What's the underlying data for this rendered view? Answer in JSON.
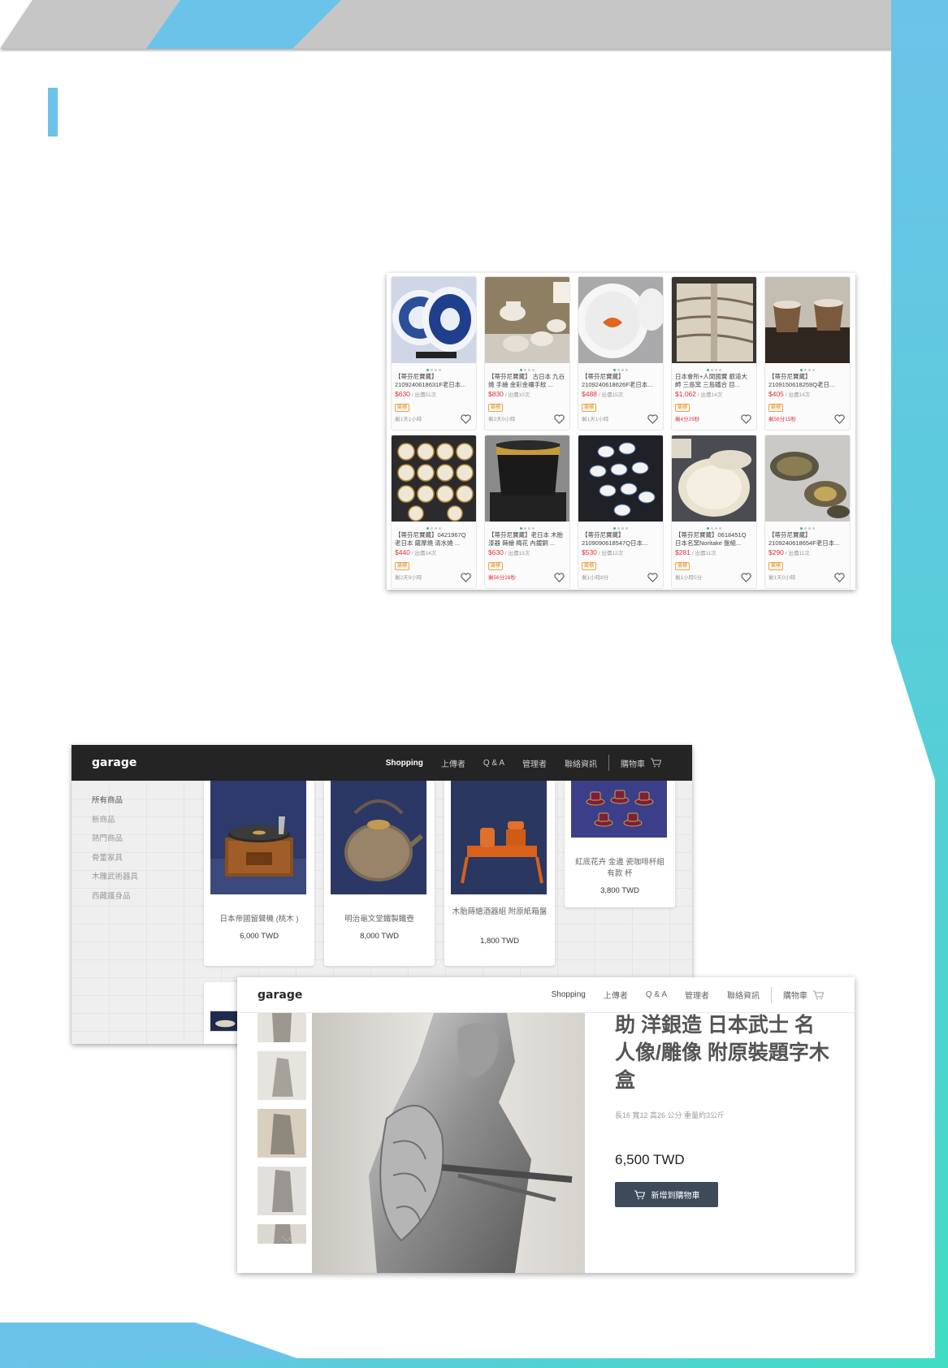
{
  "colors": {
    "accent_blue": "#6cc3ea",
    "accent_teal": "#47d9c6",
    "band_gray": "#c4c4c4",
    "price_red": "#e0323a",
    "navbar_dark": "#242424",
    "button_dark": "#3c4a5a"
  },
  "grid_screenshot": {
    "products": [
      {
        "title": "【蒂芬尼寶藏】2109240618631F老日本...",
        "price": "$630",
        "bids": " / 出價51次",
        "badge": "競標",
        "time": "剩1天1小時",
        "time_color": "gray",
        "icon": "blue-white-plates"
      },
      {
        "title": "【蒂芬尼寶藏】 古日本 九谷燒 手繪 金彩金襴手紋 ...",
        "price": "$830",
        "bids": " / 出價10次",
        "badge": "競標",
        "time": "剩2天0小時",
        "time_color": "gray",
        "icon": "kutani-tea-set"
      },
      {
        "title": "【蒂芬尼寶藏】2109240618626F老日本...",
        "price": "$488",
        "bids": " / 出價15次",
        "badge": "競標",
        "time": "剩1天1小時",
        "time_color": "gray",
        "icon": "goldfish-bowl"
      },
      {
        "title": "日本會所+人間國寶 叡道大師 三島窯 三島鐵合 目...",
        "price": "$1,062",
        "bids": " / 出價14次",
        "badge": "競標",
        "time": "剩4分29秒",
        "time_color": "red",
        "icon": "stoneware-vessel"
      },
      {
        "title": "【蒂芬尼寶藏】2109150618259Q老日...",
        "price": "$405",
        "bids": " / 出價14次",
        "badge": "競標",
        "time": "剩56分15秒",
        "time_color": "red",
        "icon": "brown-cups"
      },
      {
        "title": "【蒂芬尼寶藏】0421967Q 老日本 薩摩燒 清水燒 ...",
        "price": "$440",
        "bids": " / 出價14次",
        "badge": "競標",
        "time": "剩2天9小時",
        "time_color": "gray",
        "icon": "satsuma-cups"
      },
      {
        "title": "【蒂芬尼寶藏】老日本 木胎 漆器 蒔繪 梅花 內鍍銅 ...",
        "price": "$630",
        "bids": " / 出價13次",
        "badge": "競標",
        "time": "剩56分28秒",
        "time_color": "red",
        "icon": "lacquer-brazier"
      },
      {
        "title": "【蒂芬尼寶藏】2109090618547Q日本...",
        "price": "$530",
        "bids": " / 出價12次",
        "badge": "競標",
        "time": "剩1小時8分",
        "time_color": "gray",
        "icon": "white-tea-cups"
      },
      {
        "title": "【蒂芬尼寶藏】0618451Q 日本名窯Noritake 盤組...",
        "price": "$281",
        "bids": " / 出價11次",
        "badge": "競標",
        "time": "剩1小時5分",
        "time_color": "gray",
        "icon": "noritake-plates"
      },
      {
        "title": "【蒂芬尼寶藏】2109240618654F老日本...",
        "price": "$290",
        "bids": " / 出價11次",
        "badge": "競標",
        "time": "剩1天0小時",
        "time_color": "gray",
        "icon": "gold-plates"
      }
    ]
  },
  "shop_screenshot": {
    "logo": "garage",
    "nav": {
      "shopping": "Shopping",
      "uploader": "上傳者",
      "qa": "Q & A",
      "admin": "管理者",
      "contact": "聯絡資訊",
      "cart": "購物車"
    },
    "categories": [
      "所有商品",
      "新商品",
      "熱門商品",
      "骨董家具",
      "木雕武術器具",
      "西藏護身品"
    ],
    "products": [
      {
        "name": "日本帝國留聲機 (桃木 )",
        "price": "6,000 TWD",
        "icon": "gramophone"
      },
      {
        "name": "明治龜文堂鐵製鐵壺",
        "price": "8,000 TWD",
        "icon": "iron-kettle"
      },
      {
        "name": "木胎蒔繪酒器組 附原紙箱盤",
        "price": "1,800 TWD",
        "icon": "lacquer-sake-set"
      },
      {
        "name": "紅底花卉 金邊 瓷咖啡杯組 有款 杯",
        "price": "3,800 TWD",
        "icon": "coffee-cups"
      }
    ]
  },
  "detail_screenshot": {
    "logo": "garage",
    "nav": {
      "shopping": "Shopping",
      "uploader": "上傳者",
      "qa": "Q & A",
      "admin": "管理者",
      "contact": "聯絡資訊",
      "cart": "購物車"
    },
    "title": "助 洋銀造 日本武士 名人像/雕像 附原裝題字木盒",
    "spec": "長16 寬12 高26 公分 重量約3公斤",
    "price": "6,500 TWD",
    "add_to_cart": "新增到購物車"
  }
}
